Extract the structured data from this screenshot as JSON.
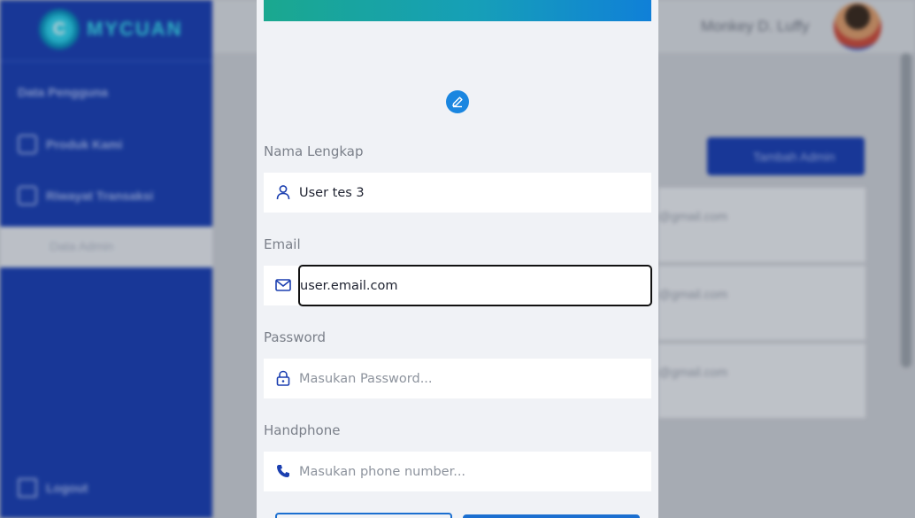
{
  "background": {
    "brand_name": "MYCUAN",
    "brand_letter": "C",
    "sidebar": {
      "items": [
        {
          "label": "Data Pengguna"
        },
        {
          "label": "Produk Kami"
        },
        {
          "label": "Riwayat Transaksi"
        },
        {
          "label": "Data Admin"
        },
        {
          "label": "Logout"
        }
      ]
    },
    "user_name": "Monkey D. Luffy",
    "add_admin_label": "Tambah Admin",
    "rows": [
      "@gmail.com",
      "@gmail.com",
      "@gmail.com"
    ]
  },
  "form": {
    "fields": [
      {
        "label": "Nama Lengkap",
        "value": "User tes 3",
        "placeholder": "",
        "icon": "user-icon"
      },
      {
        "label": "Email",
        "value": "user.email.com",
        "placeholder": "",
        "icon": "mail-icon"
      },
      {
        "label": "Password",
        "value": "",
        "placeholder": "Masukan Password...",
        "icon": "lock-icon"
      },
      {
        "label": "Handphone",
        "value": "",
        "placeholder": "Masukan phone number...",
        "icon": "phone-icon"
      }
    ]
  },
  "colors": {
    "primary": "#1b3fb0",
    "accent": "#1a86e0",
    "modal_bg": "#f0f2f6"
  }
}
